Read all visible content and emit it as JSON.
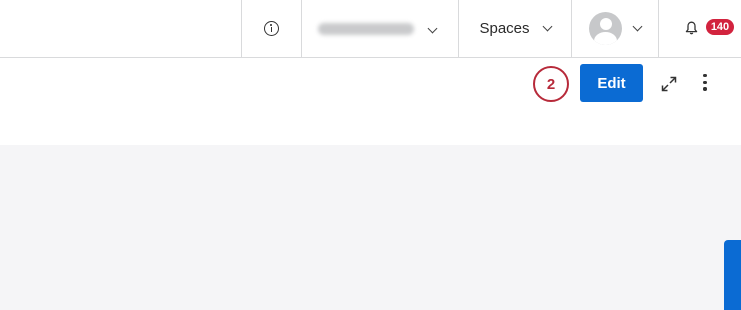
{
  "header": {
    "account_selector": {
      "value": "",
      "blurred": true
    },
    "spaces_label": "Spaces",
    "notifications_count": "140"
  },
  "toolbar": {
    "step_number": "2",
    "edit_label": "Edit"
  },
  "colors": {
    "primary": "#0b6bd3",
    "badge": "#d2233e",
    "step_marker": "#b72a3a",
    "content_background": "#f5f5f7"
  },
  "icons": [
    "info-icon",
    "chevron-down-icon",
    "avatar-icon",
    "bell-icon",
    "expand-icon",
    "more-vertical-icon"
  ]
}
